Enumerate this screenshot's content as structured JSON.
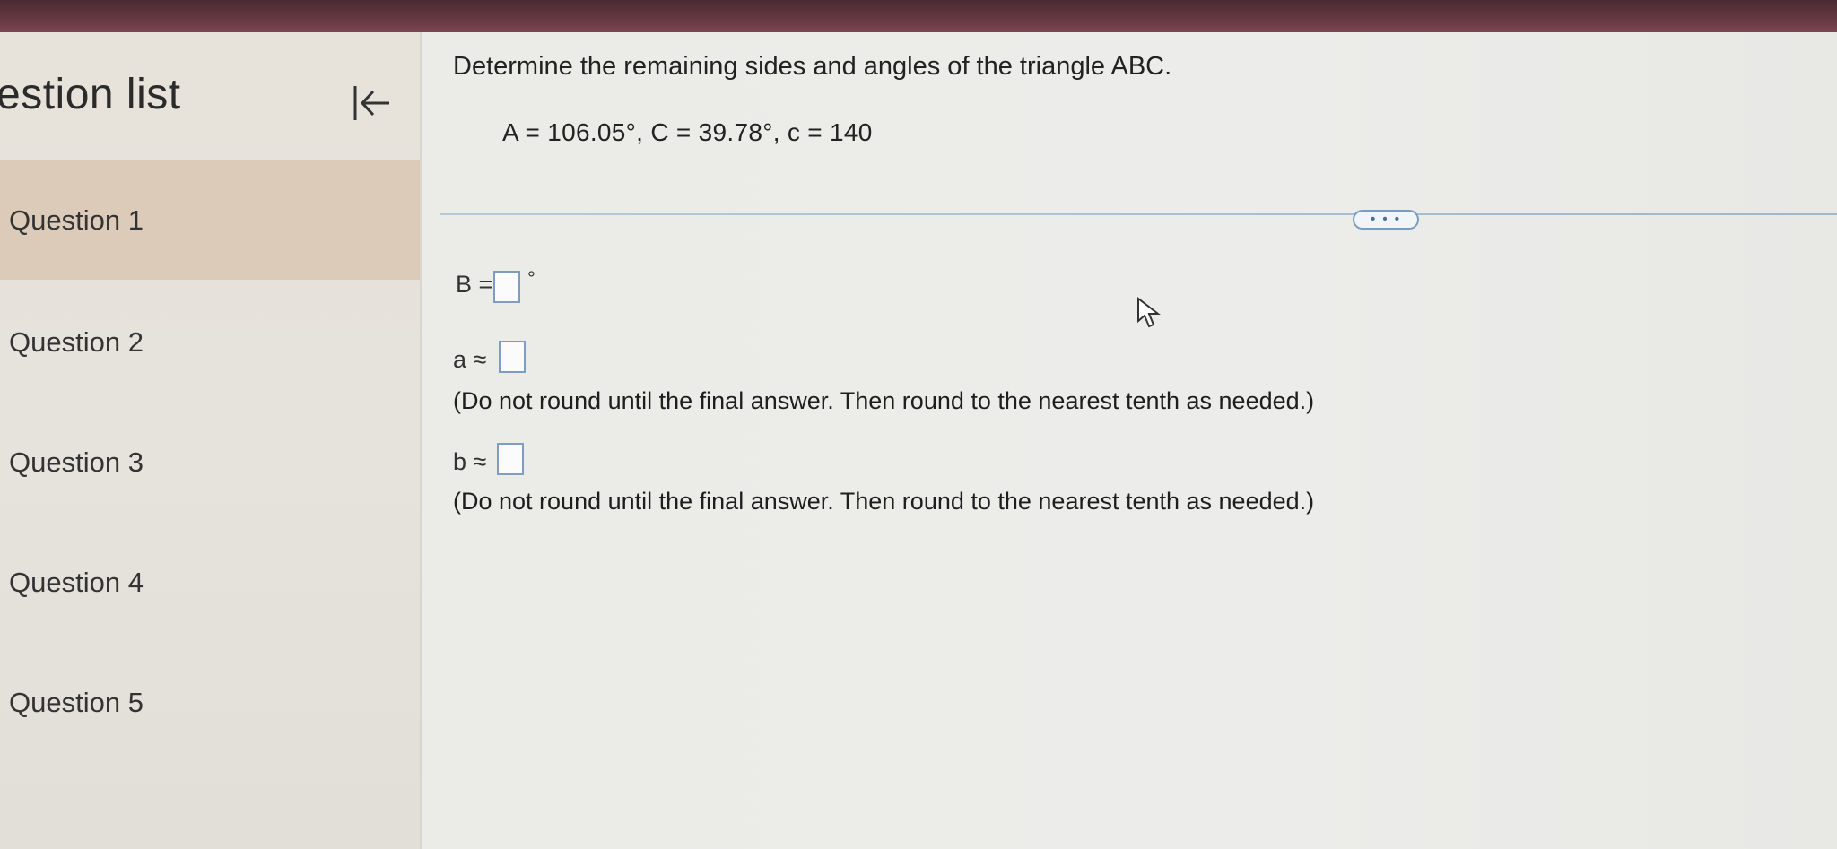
{
  "sidebar": {
    "title": "estion list",
    "items": [
      {
        "label": "Question 1",
        "active": true
      },
      {
        "label": "Question 2",
        "active": false
      },
      {
        "label": "Question 3",
        "active": false
      },
      {
        "label": "Question 4",
        "active": false
      },
      {
        "label": "Question 5",
        "active": false
      }
    ],
    "collapse_icon": "collapse-left-icon"
  },
  "question": {
    "prompt": "Determine the remaining sides and angles of the triangle ABC.",
    "givens": "A = 106.05°, C = 39.78°, c = 140",
    "more_label": "• • •",
    "answers": [
      {
        "label": "B =",
        "value": "",
        "suffix": "°"
      },
      {
        "label": "a ≈",
        "value": "",
        "hint": "(Do not round until the final answer. Then round to the nearest tenth as needed.)"
      },
      {
        "label": "b ≈",
        "value": "",
        "hint": "(Do not round until the final answer. Then round to the nearest tenth as needed.)"
      }
    ]
  },
  "colors": {
    "topbar": "#6b3c45",
    "active_item": "#dccbb8",
    "input_border": "#7f9cc2"
  }
}
